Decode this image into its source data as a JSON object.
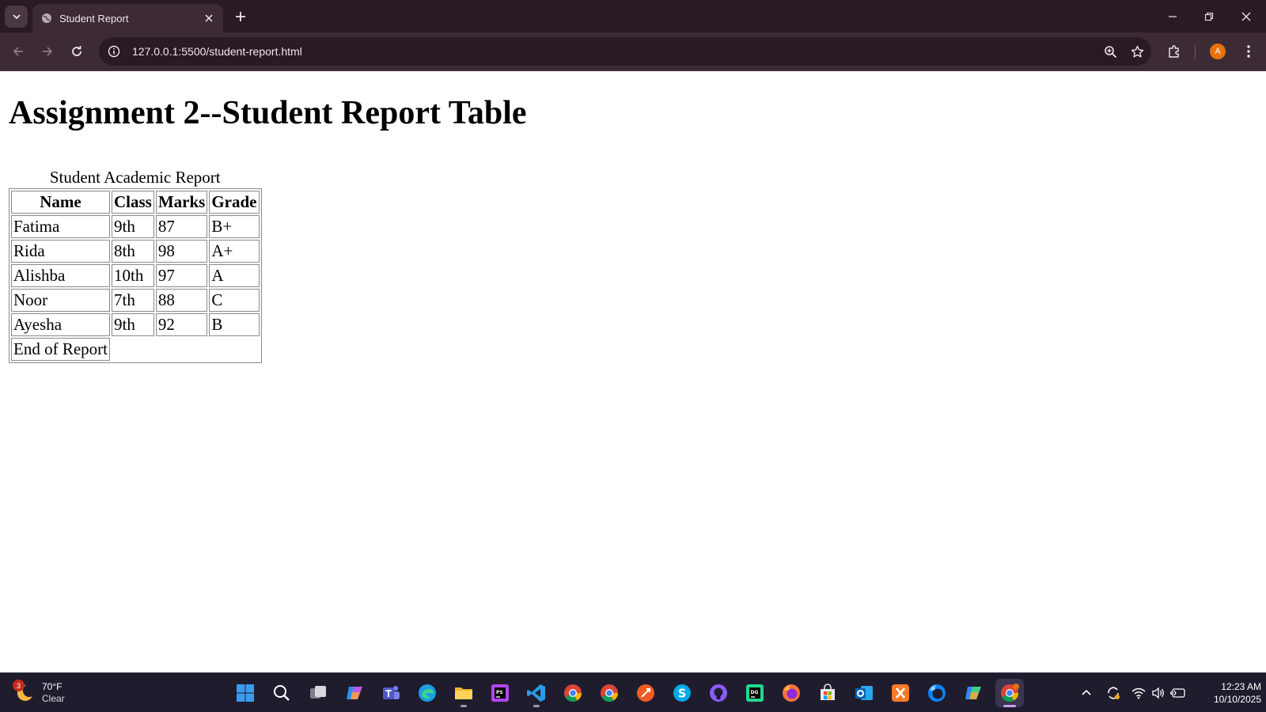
{
  "browser": {
    "tab_title": "Student Report",
    "url": "127.0.0.1:5500/student-report.html",
    "profile_initial": "A",
    "accent_color": "#e8710a"
  },
  "page": {
    "heading": "Assignment 2--Student Report Table",
    "table": {
      "caption": "Student Academic Report",
      "headers": [
        "Name",
        "Class",
        "Marks",
        "Grade"
      ],
      "rows": [
        [
          "Fatima",
          "9th",
          "87",
          "B+"
        ],
        [
          "Rida",
          "8th",
          "98",
          "A+"
        ],
        [
          "Alishba",
          "10th",
          "97",
          "A"
        ],
        [
          "Noor",
          "7th",
          "88",
          "C"
        ],
        [
          "Ayesha",
          "9th",
          "92",
          "B"
        ]
      ],
      "footer": "End of Report"
    }
  },
  "taskbar": {
    "weather": {
      "temperature": "70°F",
      "condition": "Clear",
      "badge": "3"
    },
    "apps": [
      "windows-start",
      "search",
      "task-view",
      "copilot",
      "teams",
      "edge",
      "file-explorer",
      "photoshop",
      "vscode",
      "chrome",
      "chrome-alt",
      "postman",
      "skype",
      "github-desktop",
      "datagrip",
      "firefox",
      "microsoft-store",
      "outlook",
      "xampp",
      "firefox-dev",
      "copilot-m365",
      "chrome-active"
    ],
    "time": "12:23 AM",
    "date": "10/10/2025"
  }
}
